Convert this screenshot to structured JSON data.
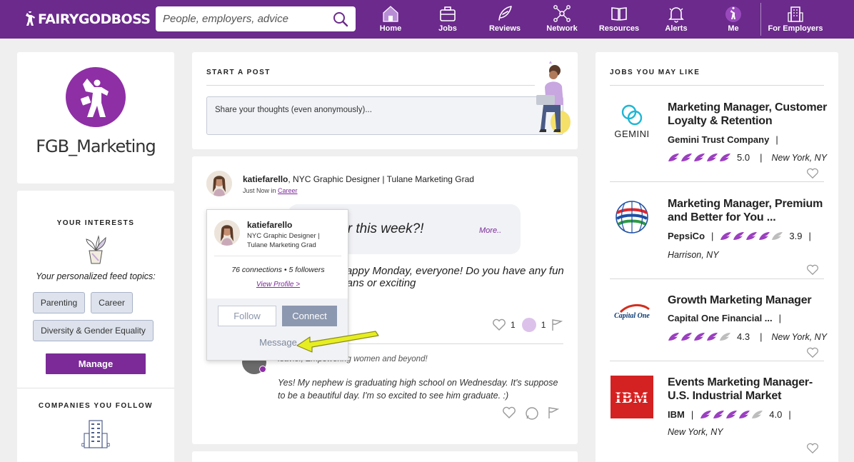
{
  "brand": {
    "name": "FAIRYGODBOSS",
    "accent": "#6b2a8c",
    "link": "#7b2a98"
  },
  "search": {
    "placeholder": "People, employers, advice"
  },
  "nav": [
    {
      "label": "Home",
      "icon": "home-icon"
    },
    {
      "label": "Jobs",
      "icon": "briefcase-icon"
    },
    {
      "label": "Reviews",
      "icon": "feather-icon"
    },
    {
      "label": "Network",
      "icon": "network-icon"
    },
    {
      "label": "Resources",
      "icon": "book-icon"
    },
    {
      "label": "Alerts",
      "icon": "bell-icon"
    },
    {
      "label": "Me",
      "icon": "avatar-icon"
    },
    {
      "label": "For Employers",
      "icon": "building-icon"
    }
  ],
  "profile": {
    "name": "FGB_Marketing"
  },
  "interests": {
    "title": "YOUR INTERESTS",
    "feed_label": "Your personalized feed topics:",
    "chips": [
      "Parenting",
      "Career",
      "Diversity & Gender Equality"
    ],
    "manage_label": "Manage"
  },
  "companies": {
    "title": "COMPANIES YOU FOLLOW"
  },
  "start_post": {
    "title": "START A POST",
    "placeholder": "Share your thoughts (even anonymously)..."
  },
  "post": {
    "author": "katiefarello",
    "author_title": ", NYC Graphic Designer | Tulane Marketing Grad",
    "time": "Just Now in ",
    "category": "Career",
    "question": "Who's excited for this week?!",
    "more": "More..",
    "body": "Happy Monday, everyone! Do you have any fun plans or exciting",
    "likes": "1",
    "comments": "1",
    "comment": {
      "author_line": "Isaviel, Empowering women and beyond!",
      "text": "Yes!  My nephew is graduating high school on Wednesday.  It's suppose to be a beautiful day. I'm so excited to see him graduate. :)"
    }
  },
  "popup": {
    "name": "katiefarello",
    "subtitle": "NYC Graphic Designer | Tulane Marketing Grad",
    "stats": "76 connections  •  5 followers",
    "view_profile": "View Profile >",
    "follow": "Follow",
    "connect": "Connect",
    "message": "Message"
  },
  "jobs": {
    "title": "JOBS YOU MAY LIKE",
    "items": [
      {
        "title": "Marketing Manager, Customer Loyalty & Retention",
        "company": "Gemini Trust Company",
        "rating": "5.0",
        "rating_value": 5,
        "location": "New York, NY",
        "logo": "gemini-logo"
      },
      {
        "title": "Marketing Manager, Premium and Better for You ...",
        "company": "PepsiCo",
        "rating": "3.9",
        "rating_value": 3.9,
        "location": "Harrison, NY",
        "logo": "pepsico-logo"
      },
      {
        "title": "Growth Marketing Manager",
        "company": "Capital One Financial ...",
        "rating": "4.3",
        "rating_value": 4.3,
        "location": "New York, NY",
        "logo": "capital-one-logo"
      },
      {
        "title": "Events Marketing Manager- U.S. Industrial Market",
        "company": "IBM",
        "rating": "4.0",
        "rating_value": 4.0,
        "location": "New York, NY",
        "logo": "ibm-logo"
      }
    ],
    "logo_text": {
      "gemini": "GEMINI",
      "capital_one": "Capital One",
      "ibm": "IBM"
    }
  }
}
